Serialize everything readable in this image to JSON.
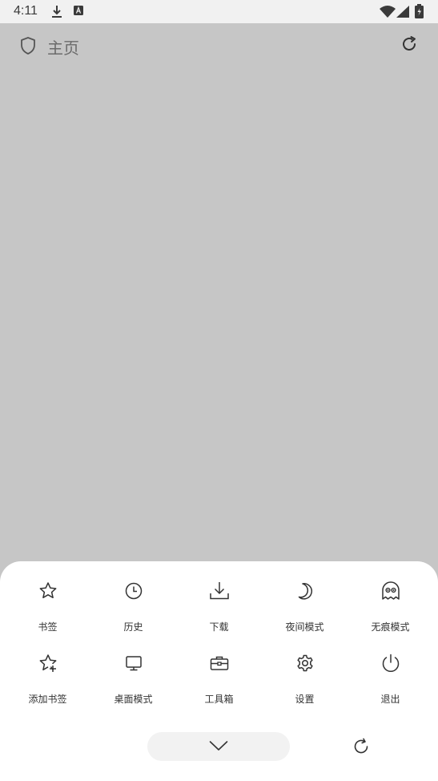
{
  "status": {
    "time": "4:11"
  },
  "header": {
    "title": "主页"
  },
  "menu": {
    "items": [
      {
        "label": "书签",
        "icon": "star-icon"
      },
      {
        "label": "历史",
        "icon": "clock-icon"
      },
      {
        "label": "下载",
        "icon": "download-icon"
      },
      {
        "label": "夜间模式",
        "icon": "moon-icon"
      },
      {
        "label": "无痕模式",
        "icon": "ghost-icon"
      },
      {
        "label": "添加书签",
        "icon": "star-plus-icon"
      },
      {
        "label": "桌面模式",
        "icon": "monitor-icon"
      },
      {
        "label": "工具箱",
        "icon": "toolbox-icon"
      },
      {
        "label": "设置",
        "icon": "gear-icon"
      },
      {
        "label": "退出",
        "icon": "power-icon"
      }
    ]
  }
}
